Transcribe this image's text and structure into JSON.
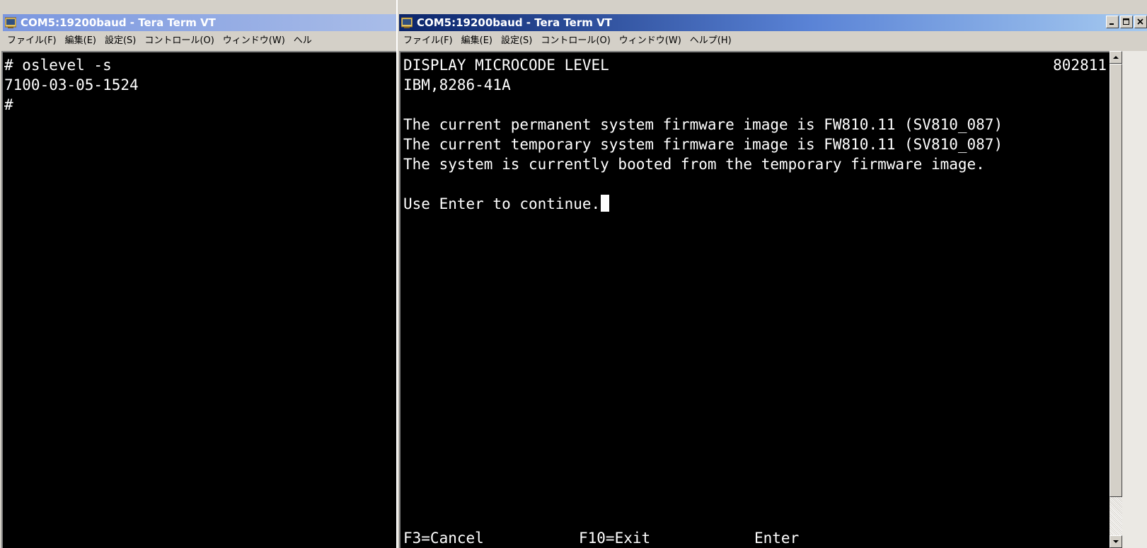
{
  "left_window": {
    "title": "COM5:19200baud - Tera Term VT",
    "menu": [
      "ファイル(F)",
      "編集(E)",
      "設定(S)",
      "コントロール(O)",
      "ウィンドウ(W)",
      "ヘル"
    ],
    "terminal_lines": [
      "# oslevel -s",
      "7100-03-05-1524",
      "#"
    ]
  },
  "right_window": {
    "title": "COM5:19200baud - Tera Term VT",
    "menu": [
      "ファイル(F)",
      "編集(E)",
      "設定(S)",
      "コントロール(O)",
      "ウィンドウ(W)",
      "ヘルプ(H)"
    ],
    "top_right_text": "802811",
    "terminal_lines": [
      "DISPLAY MICROCODE LEVEL",
      "IBM,8286-41A",
      "",
      "The current permanent system firmware image is FW810.11 (SV810_087)",
      "The current temporary system firmware image is FW810.11 (SV810_087)",
      "The system is currently booted from the temporary firmware image.",
      "",
      "Use Enter to continue."
    ],
    "function_keys": [
      "F3=Cancel",
      "F10=Exit",
      "Enter"
    ]
  },
  "icons": {
    "app_icon": "tera-term-icon",
    "minimize": "minimize-icon",
    "maximize": "maximize-icon",
    "close": "close-icon"
  },
  "colors": {
    "terminal_bg": "#000000",
    "terminal_fg": "#ffffff",
    "titlebar_active": "#0a246a",
    "titlebar_inactive": "#7a96df",
    "chrome": "#d4d0c8"
  }
}
